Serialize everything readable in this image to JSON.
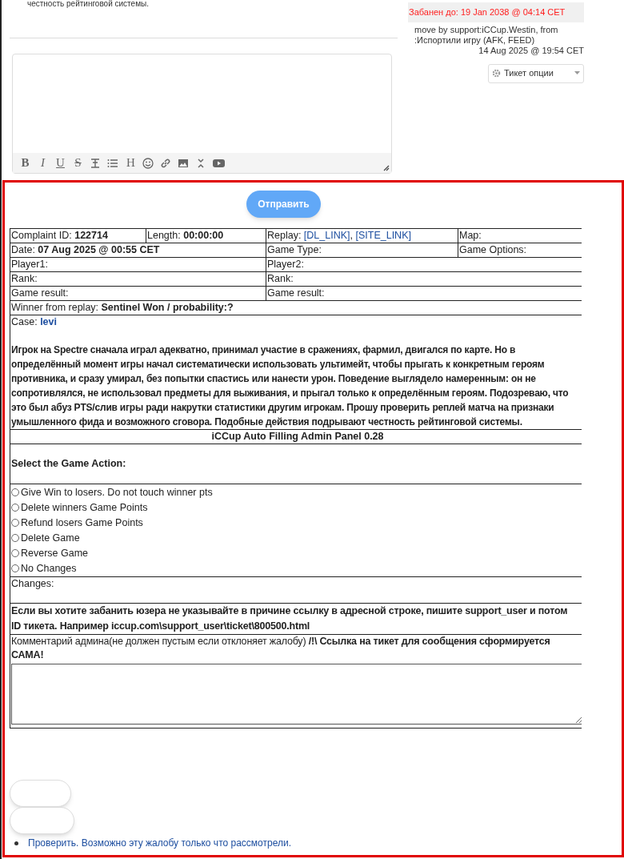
{
  "post_tail": "честность рейтинговой системы.",
  "editor": {
    "toolbar": [
      {
        "kind": "bold",
        "glyph": "B"
      },
      {
        "kind": "italic",
        "glyph": "I"
      },
      {
        "kind": "underline",
        "glyph": "U"
      },
      {
        "kind": "strike",
        "glyph": "S"
      },
      {
        "kind": "text-height"
      },
      {
        "kind": "list"
      },
      {
        "kind": "heading",
        "glyph": "H"
      },
      {
        "kind": "smiley"
      },
      {
        "kind": "link"
      },
      {
        "kind": "image"
      },
      {
        "kind": "collapse"
      },
      {
        "kind": "video"
      }
    ]
  },
  "ticket_info": {
    "ban": "Забанен до: 19 Jan 2038 @ 04:14 CET",
    "move_note": "move by support:iCCup.Westin, from :Испортили игру (AFK, FEED)",
    "date": "14 Aug 2025 @ 19:54 CET",
    "options_select": "Тикет опции"
  },
  "submit_button": "Отправить",
  "info_table": {
    "summary": [
      {
        "label": "Complaint ID:",
        "value": "122714"
      },
      {
        "label": "Length:",
        "value": "00:00:00"
      },
      {
        "label": "Replay:",
        "links": [
          "[DL_LINK]",
          "[SITE_LINK]"
        ],
        "separator": ","
      },
      {
        "label": "Map:"
      }
    ],
    "game": {
      "date_label": "Date:",
      "date": "07 Aug 2025 @ 00:55 CET",
      "type_label": "Game Type:",
      "options_label": "Game Options:"
    },
    "players": [
      {
        "player_label": "Player1:",
        "rank_label": "Rank:",
        "result_label": "Game result:"
      },
      {
        "player_label": "Player2:",
        "rank_label": "Rank:",
        "result_label": "Game result:"
      }
    ],
    "winner": {
      "label": "Winner from replay:",
      "value": "Sentinel Won / probability:?"
    },
    "case_label": "Case:",
    "case_link": "levi",
    "complaint_text": "Игрок на Spectre сначала играл адекватно, принимал участие в сражениях, фармил, двигался по карте. Но в определённый момент игры начал систематически использовать ультимейт, чтобы прыгать к конкретным героям противника, и сразу умирал, без попытки спастись или нанести урон. Поведение выглядело намеренным: он не сопротивлялся, не использовал предметы для выживания, и прыгал только к определённым героям. Подозреваю, что это был абуз PTS/слив игры ради накрутки статистики другим игрокам. Прошу проверить реплей матча на признаки умышленного фида и возможного сговора. Подобные действия подрывают честность рейтинговой системы."
  },
  "admin_panel": {
    "title": "iCCup Auto Filling Admin Panel 0.28",
    "action_heading": "Select the Game Action:",
    "actions": [
      {
        "label": "Give Win to losers. Do not touch winner pts",
        "selected": false
      },
      {
        "label": "Delete winners Game Points",
        "selected": false
      },
      {
        "label": "Refund losers Game Points",
        "selected": false
      },
      {
        "label": "Delete Game",
        "selected": false
      },
      {
        "label": "Reverse Game",
        "selected": false
      },
      {
        "label": "No Changes",
        "selected": false
      }
    ],
    "changes_label": "Changes:",
    "ban_hint": "Если вы хотите забанить юзера не указывайте в причине ссылку в адресной строке, пишите support_user и потом ID тикета. Например iccup.com\\support_user\\ticket\\800500.html",
    "comment_label": "Комментарий админа(не должен пустым если отклоняет жалобу) **/!\\ Ссылка на тикет для сообщения сформируется САМА!**"
  },
  "notice_link": "Проверить. Возможно эту жалобу только что рассмотрели."
}
